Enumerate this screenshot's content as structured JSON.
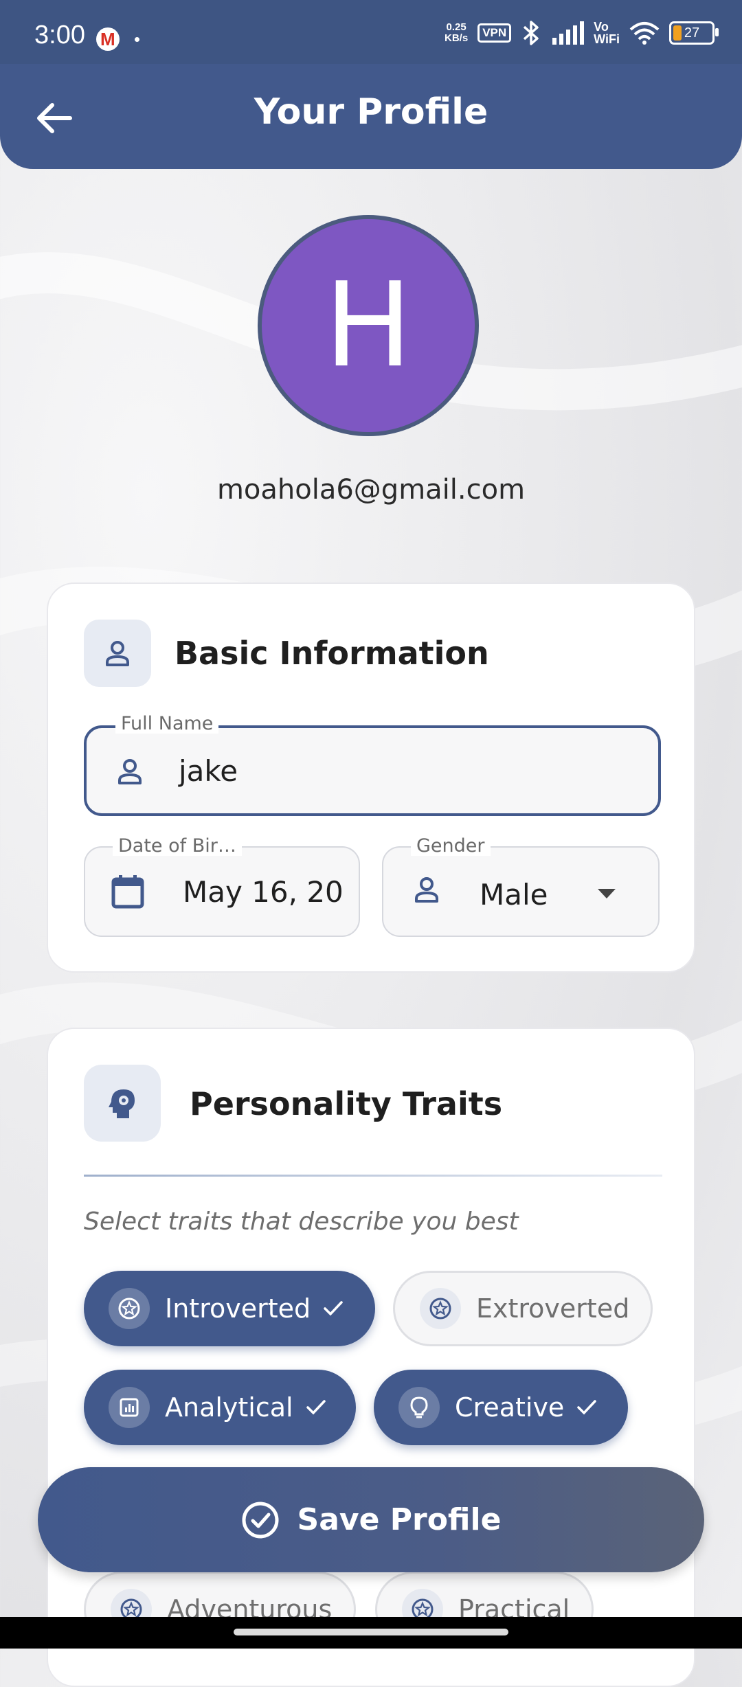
{
  "status_bar": {
    "time": "3:00",
    "gmail_glyph": "M",
    "net_speed_top": "0.25",
    "net_speed_bottom": "KB/s",
    "vpn": "VPN",
    "vowifi_top": "Vo",
    "vowifi_bottom": "WiFi",
    "battery": "27",
    "battery_level": 0.27,
    "icons": [
      "gmail-icon",
      "bluetooth-icon",
      "signal-icon",
      "wifi-icon",
      "battery-icon"
    ]
  },
  "header": {
    "title": "Your Profile",
    "back_icon": "arrow-left-icon"
  },
  "profile": {
    "avatar_letter": "H",
    "avatar_color": "#7e57c2",
    "email": "moahola6@gmail.com"
  },
  "basic_info": {
    "title": "Basic Information",
    "icon": "person-icon",
    "full_name": {
      "label": "Full Name",
      "value": "jake"
    },
    "dob": {
      "label": "Date of Bir…",
      "value": "May 16, 20"
    },
    "gender": {
      "label": "Gender",
      "value": "Male"
    }
  },
  "personality": {
    "title": "Personality Traits",
    "icon": "head-gear-icon",
    "hint": "Select traits that describe you best",
    "traits": [
      {
        "label": "Introverted",
        "selected": true,
        "icon": "star-badge-icon"
      },
      {
        "label": "Extroverted",
        "selected": false,
        "icon": "star-badge-icon"
      },
      {
        "label": "Analytical",
        "selected": true,
        "icon": "chart-icon"
      },
      {
        "label": "Creative",
        "selected": true,
        "icon": "lightbulb-icon"
      },
      {
        "label": "Adventurous",
        "selected": false,
        "icon": "star-badge-icon"
      },
      {
        "label": "Practical",
        "selected": false,
        "icon": "star-badge-icon"
      }
    ]
  },
  "save_button": {
    "label": "Save Profile",
    "icon": "check-circle-icon"
  },
  "colors": {
    "primary": "#42598c",
    "status_bar": "#3e5583",
    "avatar": "#7e57c2"
  }
}
